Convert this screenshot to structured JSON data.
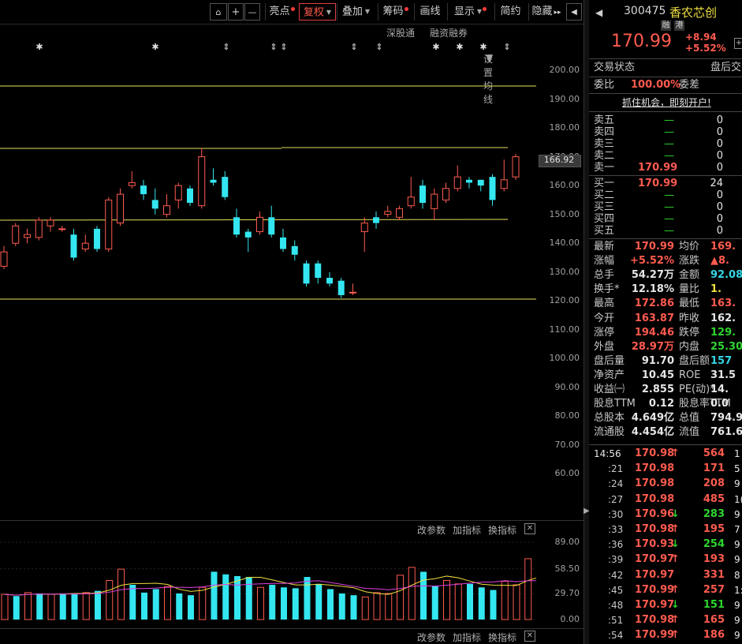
{
  "toolbar": {
    "icons": [
      "lock-icon",
      "plus-icon",
      "minus-icon"
    ],
    "buttons": [
      {
        "label": "亮点",
        "dot": true
      },
      {
        "label": "复权",
        "caret": true,
        "active": true
      },
      {
        "label": "叠加",
        "caret": true
      },
      {
        "label": "筹码",
        "dot": true
      },
      {
        "label": "画线"
      },
      {
        "label": "显示",
        "caret": true,
        "dot": true
      },
      {
        "label": "简约"
      },
      {
        "label": "隐藏"
      }
    ]
  },
  "subbar": {
    "shengutong": "深股通",
    "rongzi": "融资融券",
    "ma_setting": "设置均线"
  },
  "main_chart": {
    "y_labels": [
      "200.00",
      "190.00",
      "180.00",
      "170.00",
      "166.92",
      "160.00",
      "150.00",
      "140.00",
      "130.00",
      "120.00",
      "110.00",
      "100.00",
      "90.00",
      "80.00",
      "70.00",
      "60.00"
    ],
    "current_price_tag": "166.92",
    "ylim": [
      55,
      205
    ]
  },
  "volume_chart": {
    "toolbar": {
      "params": "改参数",
      "add": "加指标",
      "switch": "换指标"
    },
    "y_labels": [
      "89.00",
      "58.50",
      "29.70",
      "0.00"
    ],
    "ylim": [
      0,
      89
    ]
  },
  "bottom_toolbar": {
    "params": "改参数",
    "add": "加指标",
    "switch": "换指标"
  },
  "chart_data": {
    "type": "candlestick",
    "candles": [
      {
        "o": 132,
        "c": 137,
        "h": 139,
        "l": 131
      },
      {
        "o": 140,
        "c": 146,
        "h": 147,
        "l": 139
      },
      {
        "o": 142,
        "c": 143,
        "h": 145,
        "l": 140
      },
      {
        "o": 142,
        "c": 148,
        "h": 149,
        "l": 141
      },
      {
        "o": 146,
        "c": 148,
        "h": 149,
        "l": 144
      },
      {
        "o": 145,
        "c": 145,
        "h": 146,
        "l": 144
      },
      {
        "o": 143,
        "c": 135,
        "h": 145,
        "l": 134
      },
      {
        "o": 138,
        "c": 140,
        "h": 143,
        "l": 137
      },
      {
        "o": 145,
        "c": 138,
        "h": 146,
        "l": 137
      },
      {
        "o": 138,
        "c": 155,
        "h": 156,
        "l": 137
      },
      {
        "o": 147,
        "c": 157,
        "h": 159,
        "l": 146
      },
      {
        "o": 160,
        "c": 161,
        "h": 165,
        "l": 159
      },
      {
        "o": 160,
        "c": 157,
        "h": 162,
        "l": 155
      },
      {
        "o": 155,
        "c": 152,
        "h": 159,
        "l": 150
      },
      {
        "o": 150,
        "c": 153,
        "h": 157,
        "l": 149
      },
      {
        "o": 155,
        "c": 160,
        "h": 161,
        "l": 152
      },
      {
        "o": 159,
        "c": 154,
        "h": 160,
        "l": 153
      },
      {
        "o": 153,
        "c": 170,
        "h": 173,
        "l": 152
      },
      {
        "o": 162,
        "c": 161,
        "h": 166,
        "l": 160
      },
      {
        "o": 163,
        "c": 156,
        "h": 165,
        "l": 155
      },
      {
        "o": 149,
        "c": 143,
        "h": 152,
        "l": 142
      },
      {
        "o": 144,
        "c": 142,
        "h": 145,
        "l": 137
      },
      {
        "o": 144,
        "c": 149,
        "h": 151,
        "l": 143
      },
      {
        "o": 149,
        "c": 143,
        "h": 153,
        "l": 142
      },
      {
        "o": 142,
        "c": 138,
        "h": 145,
        "l": 137
      },
      {
        "o": 139,
        "c": 136,
        "h": 141,
        "l": 134
      },
      {
        "o": 133,
        "c": 126,
        "h": 134,
        "l": 125
      },
      {
        "o": 133,
        "c": 128,
        "h": 134,
        "l": 126
      },
      {
        "o": 128,
        "c": 126,
        "h": 130,
        "l": 125
      },
      {
        "o": 127,
        "c": 122,
        "h": 128,
        "l": 121
      },
      {
        "o": 123,
        "c": 123,
        "h": 126,
        "l": 122
      },
      {
        "o": 144,
        "c": 147,
        "h": 149,
        "l": 137
      },
      {
        "o": 149,
        "c": 147,
        "h": 151,
        "l": 145
      },
      {
        "o": 150,
        "c": 151,
        "h": 153,
        "l": 149
      },
      {
        "o": 149,
        "c": 152,
        "h": 153,
        "l": 148
      },
      {
        "o": 153,
        "c": 156,
        "h": 163,
        "l": 152
      },
      {
        "o": 160,
        "c": 154,
        "h": 162,
        "l": 152
      },
      {
        "o": 152,
        "c": 157,
        "h": 159,
        "l": 148
      },
      {
        "o": 155,
        "c": 159,
        "h": 161,
        "l": 154
      },
      {
        "o": 159,
        "c": 163,
        "h": 167,
        "l": 158
      },
      {
        "o": 162,
        "c": 161,
        "h": 163,
        "l": 159
      },
      {
        "o": 162,
        "c": 160,
        "h": 162,
        "l": 158
      },
      {
        "o": 163,
        "c": 155,
        "h": 164,
        "l": 153
      },
      {
        "o": 159,
        "c": 162,
        "h": 169,
        "l": 158
      },
      {
        "o": 163,
        "c": 170,
        "h": 171,
        "l": 162
      }
    ],
    "volumes": [
      29,
      27,
      31,
      30,
      29,
      30,
      30,
      31,
      33,
      45,
      58,
      40,
      31,
      35,
      38,
      30,
      28,
      37,
      55,
      52,
      50,
      49,
      37,
      40,
      37,
      36,
      49,
      41,
      35,
      30,
      28,
      26,
      31,
      30,
      51,
      60,
      55,
      39,
      45,
      41,
      41,
      37,
      34,
      44,
      40,
      70,
      57
    ],
    "vol_colors": [
      "up",
      "down",
      "up",
      "down",
      "up",
      "down",
      "down",
      "up",
      "down",
      "up",
      "up",
      "down",
      "down",
      "down",
      "up",
      "down",
      "down",
      "up",
      "down",
      "down",
      "down",
      "down",
      "up",
      "down",
      "down",
      "down",
      "down",
      "down",
      "down",
      "down",
      "down",
      "up",
      "up",
      "up",
      "up",
      "up",
      "down",
      "down",
      "up",
      "up",
      "down",
      "down",
      "down",
      "up",
      "up",
      "up",
      "up"
    ],
    "markers": [
      "asterisk",
      "asterisk",
      "arrow",
      "arrow",
      "arrow",
      "arrow",
      "arrow",
      "asterisk",
      "asterisk",
      "asterisk",
      "arrow"
    ]
  },
  "quote": {
    "code": "300475",
    "name": "香农芯创",
    "badges": [
      "融",
      "港"
    ],
    "price": "170.99",
    "change": "+8.94",
    "change_pct": "+5.52%",
    "trade_status_label": "交易状态",
    "trade_status_value": "盘后交",
    "weibi_label": "委比",
    "weibi_value": "100.00%",
    "weicha_label": "委差",
    "promo": "抓住机会，即刻开户!",
    "asks": [
      {
        "label": "卖五",
        "price": "—",
        "vol": "0"
      },
      {
        "label": "卖四",
        "price": "—",
        "vol": "0"
      },
      {
        "label": "卖三",
        "price": "—",
        "vol": "0"
      },
      {
        "label": "卖二",
        "price": "—",
        "vol": "0"
      },
      {
        "label": "卖一",
        "price": "170.99",
        "vol": "0"
      }
    ],
    "bids": [
      {
        "label": "买一",
        "price": "170.99",
        "vol": "24"
      },
      {
        "label": "买二",
        "price": "—",
        "vol": "0"
      },
      {
        "label": "买三",
        "price": "—",
        "vol": "0"
      },
      {
        "label": "买四",
        "price": "—",
        "vol": "0"
      },
      {
        "label": "买五",
        "price": "—",
        "vol": "0"
      }
    ],
    "stats": [
      {
        "l1": "最新",
        "v1": "170.99",
        "c1": "red",
        "l2": "均价",
        "v2": "169.",
        "c2": "red"
      },
      {
        "l1": "涨幅",
        "v1": "+5.52%",
        "c1": "red",
        "l2": "涨跌",
        "v2": "▲8.",
        "c2": "red"
      },
      {
        "l1": "总手",
        "v1": "54.27万",
        "c1": "wht",
        "l2": "金额",
        "v2": "92.08",
        "c2": "cyn"
      },
      {
        "l1": "换手*",
        "v1": "12.18%",
        "c1": "wht",
        "l2": "量比",
        "v2": "1.",
        "c2": "yel"
      },
      {
        "l1": "最高",
        "v1": "172.86",
        "c1": "red",
        "l2": "最低",
        "v2": "163.",
        "c2": "red"
      },
      {
        "l1": "今开",
        "v1": "163.87",
        "c1": "red",
        "l2": "昨收",
        "v2": "162.",
        "c2": "wht"
      },
      {
        "l1": "涨停",
        "v1": "194.46",
        "c1": "red",
        "l2": "跌停",
        "v2": "129.",
        "c2": "grn"
      },
      {
        "l1": "外盘",
        "v1": "28.97万",
        "c1": "red",
        "l2": "内盘",
        "v2": "25.30",
        "c2": "grn"
      },
      {
        "l1": "盘后量",
        "v1": "91.70",
        "c1": "wht",
        "l2": "盘后额",
        "v2": "157",
        "c2": "cyn"
      },
      {
        "l1": "净资产",
        "v1": "10.45",
        "c1": "wht",
        "l2": "ROE",
        "v2": "31.5",
        "c2": "wht"
      },
      {
        "l1": "收益㈠",
        "v1": "2.855",
        "c1": "wht",
        "l2": "PE(动)*",
        "v2": "14.",
        "c2": "wht"
      },
      {
        "l1": "股息TTM",
        "v1": "0.12",
        "c1": "wht",
        "l2": "股息率TTM",
        "v2": "0.0",
        "c2": "wht"
      },
      {
        "l1": "总股本",
        "v1": "4.649亿",
        "c1": "wht",
        "l2": "总值",
        "v2": "794.9",
        "c2": "wht"
      },
      {
        "l1": "流通股",
        "v1": "4.454亿",
        "c1": "wht",
        "l2": "流值",
        "v2": "761.6",
        "c2": "wht"
      }
    ],
    "ticks": [
      {
        "t": "14:56",
        "p": "170.98",
        "dir": "up",
        "v": "564",
        "x": "1"
      },
      {
        "t": ":21",
        "p": "170.98",
        "dir": "",
        "v": "171",
        "x": "5"
      },
      {
        "t": ":24",
        "p": "170.98",
        "dir": "",
        "v": "208",
        "x": "9"
      },
      {
        "t": ":27",
        "p": "170.98",
        "dir": "",
        "v": "485",
        "x": "1("
      },
      {
        "t": ":30",
        "p": "170.96",
        "dir": "down",
        "v": "283",
        "x": "9"
      },
      {
        "t": ":33",
        "p": "170.98",
        "dir": "up",
        "v": "195",
        "x": "7"
      },
      {
        "t": ":36",
        "p": "170.93",
        "dir": "down",
        "v": "254",
        "x": "9"
      },
      {
        "t": ":39",
        "p": "170.97",
        "dir": "up",
        "v": "193",
        "x": "9"
      },
      {
        "t": ":42",
        "p": "170.97",
        "dir": "",
        "v": "331",
        "x": "8"
      },
      {
        "t": ":45",
        "p": "170.99",
        "dir": "up",
        "v": "257",
        "x": "1:"
      },
      {
        "t": ":48",
        "p": "170.97",
        "dir": "down",
        "v": "151",
        "x": "9"
      },
      {
        "t": ":51",
        "p": "170.98",
        "dir": "up",
        "v": "165",
        "x": "9"
      },
      {
        "t": ":54",
        "p": "170.99",
        "dir": "up",
        "v": "186",
        "x": "9"
      }
    ]
  }
}
